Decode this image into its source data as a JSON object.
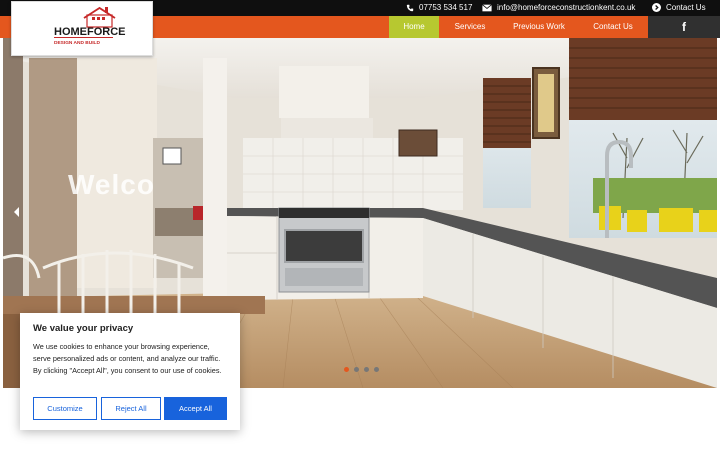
{
  "topbar": {
    "phone": "07753 534 517",
    "email": "info@homeforceconstructionkent.co.uk",
    "contact": "Contact Us"
  },
  "logo": {
    "name": "HOMEFORCE",
    "tagline": "DESIGN AND BUILD"
  },
  "nav": {
    "items": [
      {
        "label": "Home",
        "active": true
      },
      {
        "label": "Services"
      },
      {
        "label": "Previous Work"
      },
      {
        "label": "Contact Us"
      }
    ],
    "facebook": "f"
  },
  "hero": {
    "heading": "Welco",
    "slide_count": 4,
    "active_slide": 1
  },
  "cookie": {
    "title": "We value your privacy",
    "text": "We use cookies to enhance your browsing experience, serve personalized ads or content, and analyze our traffic. By clicking \"Accept All\", you consent to our use of cookies.",
    "customize": "Customize",
    "reject": "Reject All",
    "accept": "Accept All"
  },
  "colors": {
    "accent": "#e4571e",
    "nav_active": "#b7c830",
    "cookie_blue": "#1863dc",
    "topbar": "#0f0f0f"
  }
}
